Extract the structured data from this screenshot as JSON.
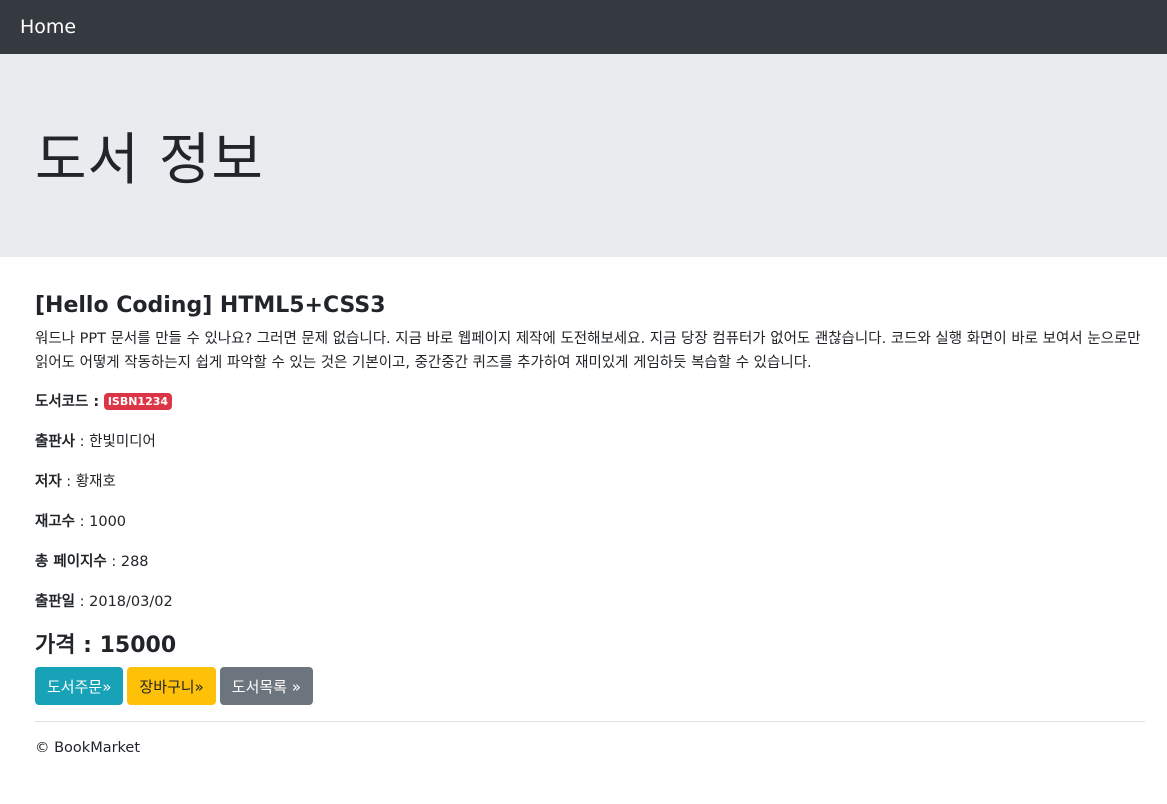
{
  "nav": {
    "brand": "Home"
  },
  "jumbotron": {
    "title": "도서 정보"
  },
  "book": {
    "title": "[Hello Coding] HTML5+CSS3",
    "description": "워드나 PPT 문서를 만들 수 있나요? 그러면 문제 없습니다. 지금 바로 웹페이지 제작에 도전해보세요. 지금 당장 컴퓨터가 없어도 괜찮습니다. 코드와 실행 화면이 바로 보여서 눈으로만 읽어도 어떻게 작동하는지 쉽게 파악할 수 있는 것은 기본이고, 중간중간 퀴즈를 추가하여 재미있게 게임하듯 복습할 수 있습니다.",
    "code_label": "도서코드 :",
    "code": "ISBN1234",
    "publisher_label": "출판사",
    "publisher": " : 한빛미디어",
    "author_label": "저자",
    "author": " : 황재호",
    "stock_label": "재고수",
    "stock": " : 1000",
    "pages_label": "총 페이지수",
    "pages": " : 288",
    "release_label": "출판일",
    "release": " : 2018/03/02",
    "price_label": "가격 : ",
    "price": "15000"
  },
  "actions": {
    "order": "도서주문»",
    "cart": "장바구니»",
    "list": "도서목록 »"
  },
  "colors": {
    "navbar": "#343a40",
    "jumbotron": "#e9ecef",
    "badge": "#dc3545",
    "btn_info": "#17a2b8",
    "btn_warning": "#ffc107",
    "btn_secondary": "#6c757d"
  },
  "footer": {
    "text": "© BookMarket"
  }
}
